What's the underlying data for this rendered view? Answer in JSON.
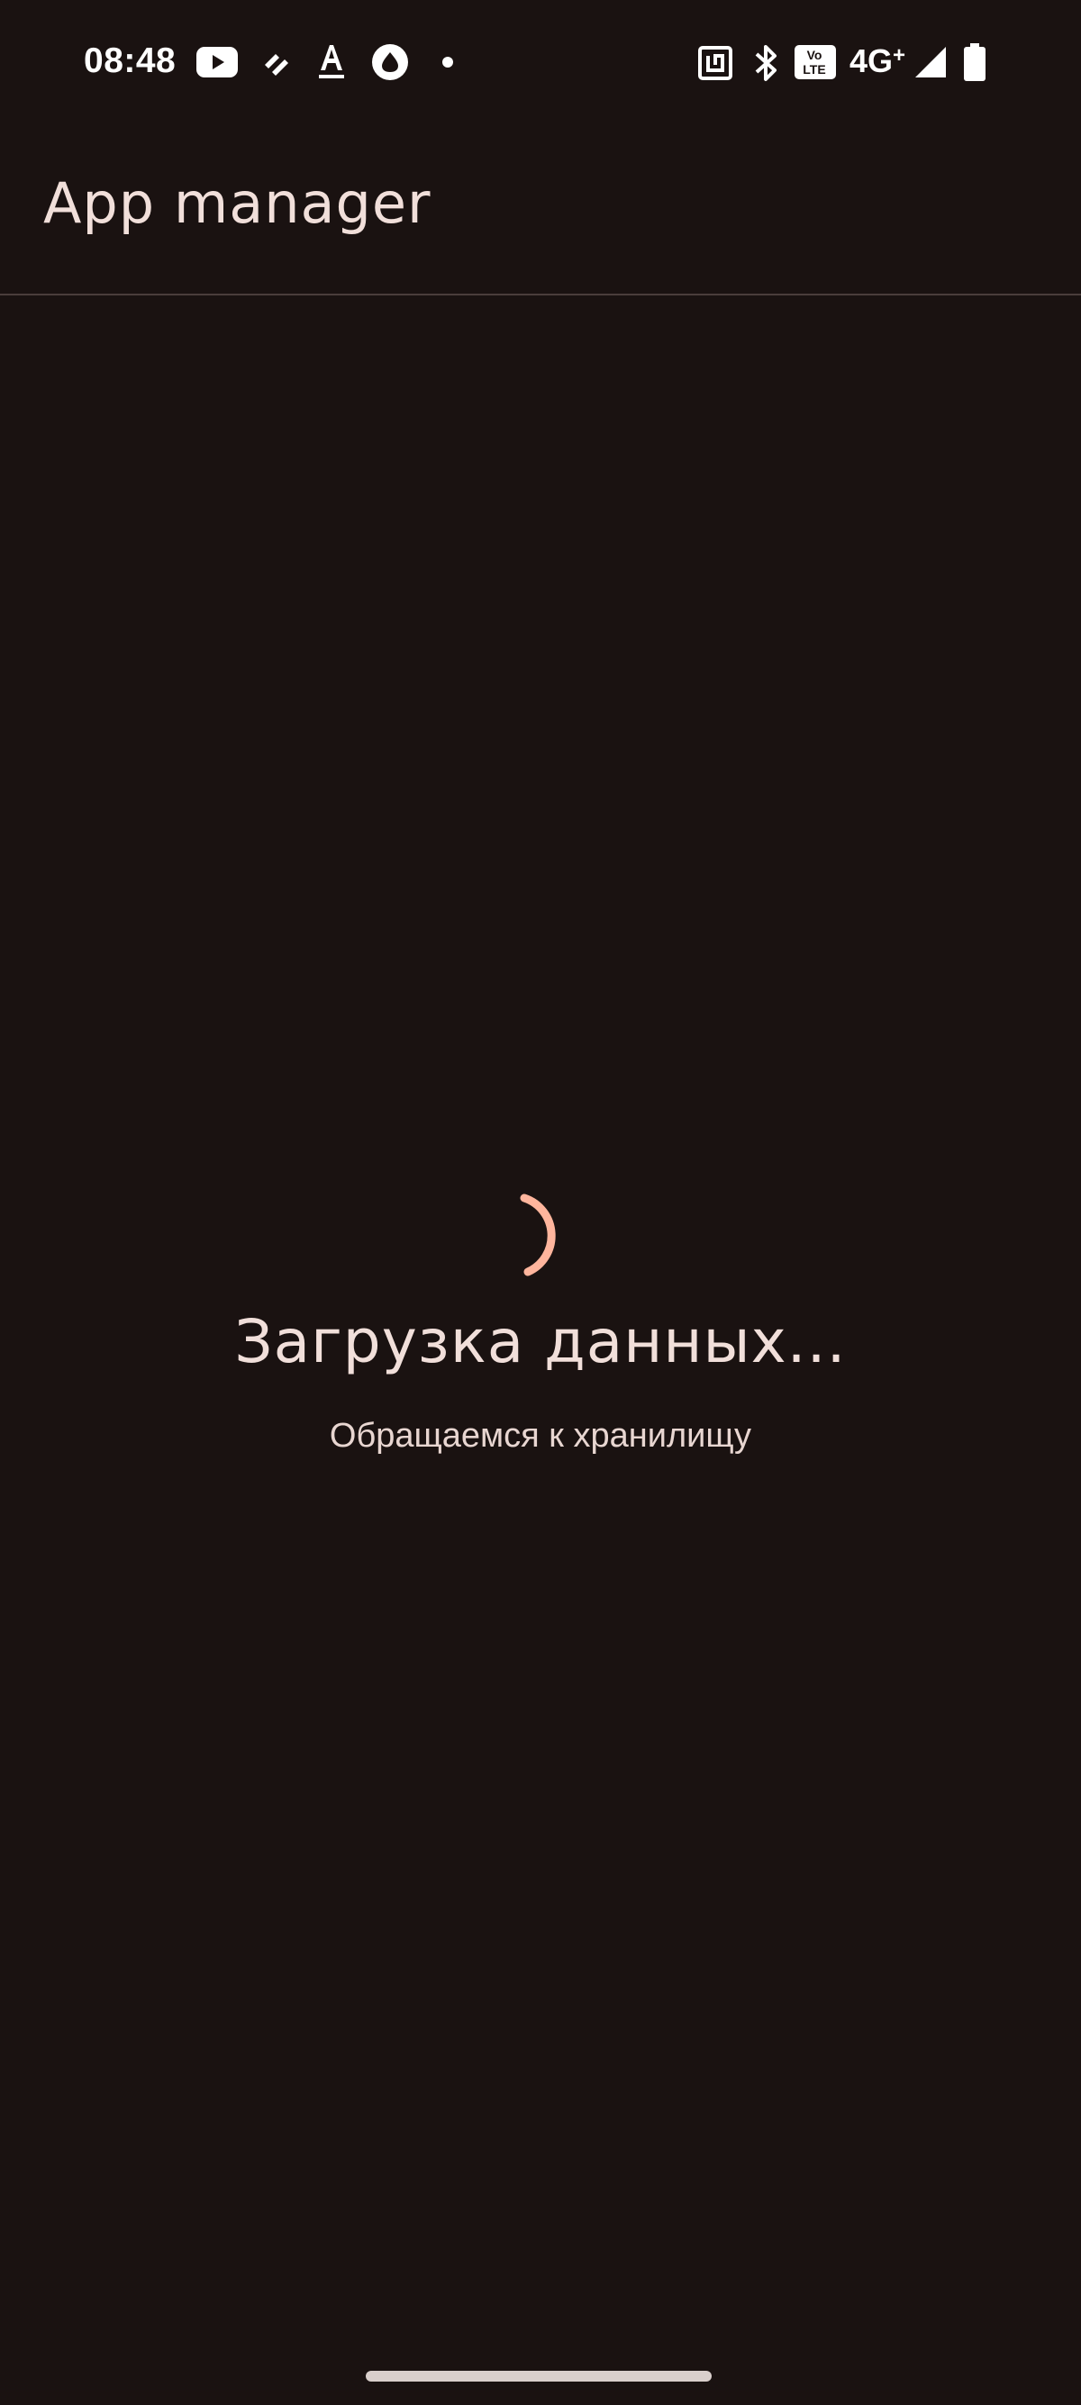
{
  "status_bar": {
    "time": "08:48",
    "network": "4G",
    "network_plus": "+",
    "volte_top": "Vo",
    "volte_bottom": "LTE",
    "notification_icons": [
      "youtube-icon",
      "app-notification-icon",
      "text-a-icon",
      "alice-icon",
      "more-dot-icon"
    ],
    "system_icons": [
      "nfc-icon",
      "bluetooth-icon",
      "volte-icon",
      "signal-icon",
      "battery-icon"
    ]
  },
  "app_bar": {
    "title": "App manager"
  },
  "loading": {
    "title": "Загрузка данных...",
    "subtitle": "Обращаемся к хранилищу"
  },
  "colors": {
    "background": "#1a1211",
    "primary_text": "#f1dfda",
    "accent": "#ffb59d",
    "divider": "#4a3d3b"
  }
}
